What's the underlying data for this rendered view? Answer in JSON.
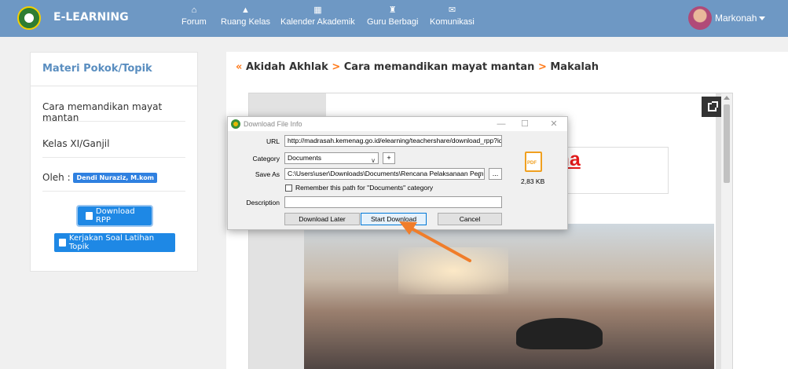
{
  "nav": {
    "brand": "E-LEARNING",
    "items": [
      {
        "label": "Forum",
        "icon": "home-icon"
      },
      {
        "label": "Ruang Kelas",
        "icon": "class-icon"
      },
      {
        "label": "Kalender Akademik",
        "icon": "calendar-icon"
      },
      {
        "label": "Guru Berbagi",
        "icon": "teacher-icon"
      },
      {
        "label": "Komunikasi",
        "icon": "mail-icon"
      }
    ],
    "user": "Markonah"
  },
  "sidebar": {
    "title": "Materi Pokok/Topik",
    "topic": "Cara memandikan mayat mantan",
    "class": "Kelas XI/Ganjil",
    "author_label": "Oleh :",
    "author": "Dendi Nuraziz, M.kom",
    "download_rpp": "Download RPP",
    "kerjakan": "Kerjakan Soal Latihan Topik"
  },
  "breadcrumb": {
    "items": [
      "Akidah Akhlak",
      "Cara memandikan mayat mantan",
      "Makalah"
    ],
    "sep": ">",
    "back": "«"
  },
  "document": {
    "heading_fragment": "sesama"
  },
  "dialog": {
    "title": "Download File Info",
    "url_label": "URL",
    "url": "http://madrasah.kemenag.go.id/elearning/teachershare/download_rpp?id=",
    "category_label": "Category",
    "category": "Documents",
    "plus": "+",
    "saveas_label": "Save As",
    "saveas": "C:\\Users\\user\\Downloads\\Documents\\Rencana Pelaksanaan Pem",
    "browse": "...",
    "remember": "Remember this path for \"Documents\" category",
    "description_label": "Description",
    "description": "",
    "file_icon_text": "PDF",
    "file_size": "2,83 KB",
    "download_later": "Download Later",
    "start_download": "Start Download",
    "cancel": "Cancel",
    "minimize": "—",
    "maximize": "☐",
    "close": "✕"
  },
  "colors": {
    "nav_bg": "#6e98c4",
    "accent_blue": "#1e88e5",
    "breadcrumb_orange": "#ff7a1a",
    "heading_red": "#e41b1b",
    "arrow_orange": "#f07d2a"
  }
}
